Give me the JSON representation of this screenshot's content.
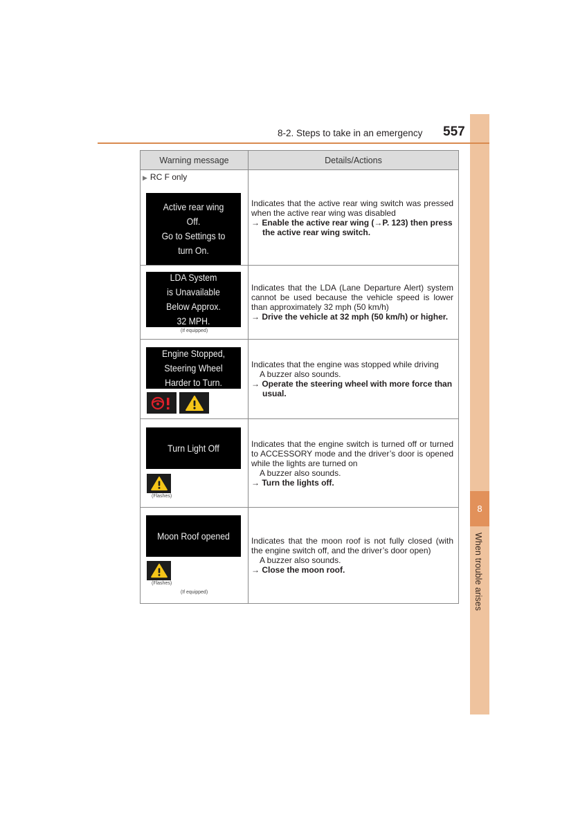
{
  "header": {
    "section_title": "8-2. Steps to take in an emergency",
    "page_number": "557"
  },
  "side_tab": {
    "chapter_number": "8",
    "chapter_title": "When trouble arises"
  },
  "colors": {
    "accent_orange": "#d98a4e",
    "tab_light": "#efc39e",
    "tab_dark": "#e2915a",
    "warning_yellow": "#f5c518",
    "warning_red": "#e0202a"
  },
  "table": {
    "headers": [
      "Warning message",
      "Details/Actions"
    ],
    "rows": [
      {
        "qualifier": "RC F only",
        "screen_lines": [
          "Active rear wing",
          "Off.",
          "Go to Settings to",
          "turn On."
        ],
        "details": [
          "Indicates that the active rear wing switch was pressed when the active rear wing was disabled"
        ],
        "action": "→ Enable the active rear wing (→P. 123) then press",
        "action_cont": "the active rear wing switch."
      },
      {
        "screen_lines": [
          "LDA System",
          "is Unavailable",
          "Below Approx.",
          "32 MPH."
        ],
        "note": "(If equipped)",
        "details": [
          "Indicates that the LDA (Lane Departure Alert) system cannot be used because the vehicle speed is lower than approximately 32 mph (50 km/h)"
        ],
        "action": "→ Drive the vehicle at 32 mph (50 km/h) or higher."
      },
      {
        "screen_lines": [
          "Engine Stopped,",
          "Steering Wheel",
          "Harder to Turn."
        ],
        "icons": [
          "steering-warning-icon",
          "warning-triangle-icon"
        ],
        "details": [
          "Indicates that the engine was stopped while driving"
        ],
        "buzzer": "A buzzer also sounds.",
        "action": "→ Operate the steering wheel with more force than",
        "action_cont": "usual."
      },
      {
        "screen_lines": [
          "Turn Light Off"
        ],
        "icons": [
          "warning-triangle-icon"
        ],
        "icon_note": "(Flashes)",
        "details": [
          "Indicates that the engine switch is turned off or turned to ACCESSORY mode and the driver’s door is opened while the lights are turned on"
        ],
        "buzzer": "A buzzer also sounds.",
        "action": "→ Turn the lights off."
      },
      {
        "screen_lines": [
          "Moon Roof opened"
        ],
        "icons": [
          "warning-triangle-icon"
        ],
        "icon_note": "(Flashes)",
        "note": "(If equipped)",
        "details": [
          "Indicates that the moon roof is not fully closed (with the engine switch off, and the driver’s door open)"
        ],
        "buzzer": "A buzzer also sounds.",
        "action": "→ Close the moon roof."
      }
    ]
  }
}
